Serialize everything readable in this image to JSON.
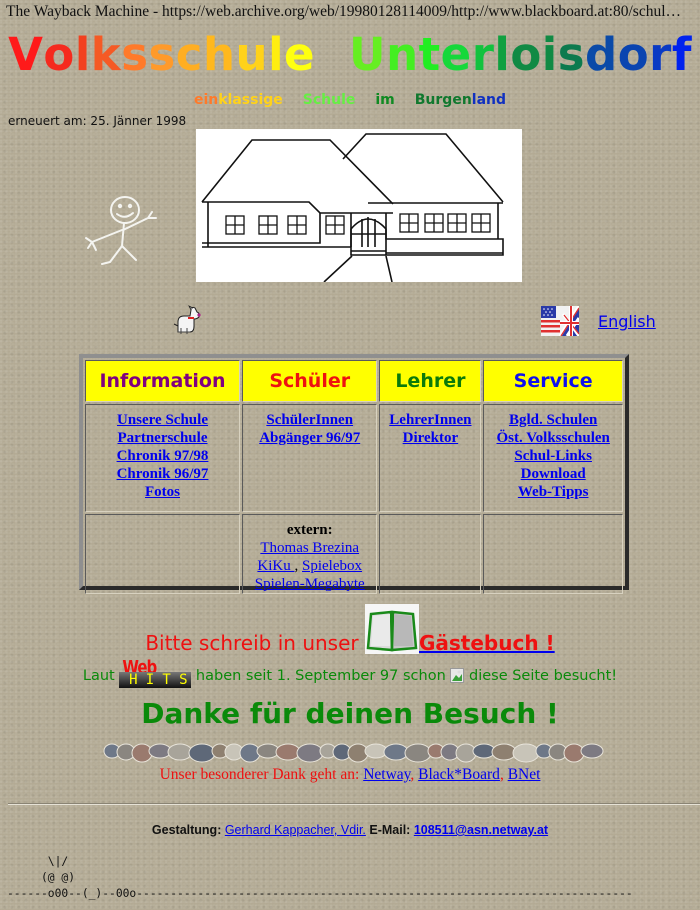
{
  "window": {
    "title": "The Wayback Machine - https://web.archive.org/web/19980128114009/http://www.blackboard.at:80/schul…"
  },
  "header": {
    "title_letters": [
      {
        "ch": "V",
        "color": "#ff1a1a"
      },
      {
        "ch": "o",
        "color": "#f52a1e"
      },
      {
        "ch": "l",
        "color": "#f2401f"
      },
      {
        "ch": "k",
        "color": "#f55a25"
      },
      {
        "ch": "s",
        "color": "#ff7a2a"
      },
      {
        "ch": "s",
        "color": "#ff9a2a"
      },
      {
        "ch": "c",
        "color": "#ffae22"
      },
      {
        "ch": "h",
        "color": "#ffb81e"
      },
      {
        "ch": "u",
        "color": "#ffd21a"
      },
      {
        "ch": "l",
        "color": "#ffee10"
      },
      {
        "ch": "e",
        "color": "#ffff10"
      },
      {
        "ch": " ",
        "color": "#000000"
      },
      {
        "ch": "U",
        "color": "#66ee22"
      },
      {
        "ch": "n",
        "color": "#44ee22"
      },
      {
        "ch": "t",
        "color": "#22ee22"
      },
      {
        "ch": "e",
        "color": "#16d83a"
      },
      {
        "ch": "r",
        "color": "#12c23e"
      },
      {
        "ch": "l",
        "color": "#10a040"
      },
      {
        "ch": "o",
        "color": "#108a44"
      },
      {
        "ch": "i",
        "color": "#108a44"
      },
      {
        "ch": "s",
        "color": "#0c7a4e"
      },
      {
        "ch": "d",
        "color": "#0a4aa8"
      },
      {
        "ch": "o",
        "color": "#0a44b0"
      },
      {
        "ch": "r",
        "color": "#0a3ac4"
      },
      {
        "ch": "f",
        "color": "#0022ee"
      }
    ],
    "subtitle_words": [
      {
        "parts": [
          {
            "text": "ein",
            "color": "#ff7a2a"
          },
          {
            "text": "klassige",
            "color": "#ffd21a"
          }
        ]
      },
      {
        "parts": [
          {
            "text": "Schule",
            "color": "#66ee44"
          }
        ]
      },
      {
        "parts": [
          {
            "text": "im",
            "color": "#108a22"
          }
        ]
      },
      {
        "parts": [
          {
            "text": "Burgen",
            "color": "#10782e"
          },
          {
            "text": "land",
            "color": "#1030c0"
          }
        ]
      }
    ],
    "updated": "erneuert am: 25. Jänner 1998"
  },
  "images": {
    "school_drawing": "school-building-drawing",
    "stickman": "chalk-stickman",
    "dog": "dog-icon",
    "flag": "uk-us-flag-icon"
  },
  "language_link": "English",
  "menu": {
    "columns": [
      {
        "heading": "Information",
        "color": "#800080",
        "links": [
          "Unsere Schule",
          "Partnerschule",
          "Chronik 97/98",
          "Chronik 96/97",
          "Fotos"
        ]
      },
      {
        "heading": "Schüler",
        "color": "#ee1111",
        "links": [
          "SchülerInnen",
          "Abgänger 96/97"
        ]
      },
      {
        "heading": "Lehrer",
        "color": "#0a7a0a",
        "links": [
          "LehrerInnen",
          "Direktor"
        ]
      },
      {
        "heading": "Service",
        "color": "#1010ee",
        "links": [
          "Bgld. Schulen",
          "Öst. Volksschulen",
          "Schul-Links",
          "Download",
          "Web-Tipps"
        ]
      }
    ],
    "extern": {
      "label": "extern:",
      "link1": "Thomas Brezina",
      "link2": "KiKu ",
      "separator": ", ",
      "link3": "Spielebox",
      "link4": "Spielen-Megabyte"
    }
  },
  "guestbook": {
    "text": "Bitte schreib in unser ",
    "link": "Gästebuch !"
  },
  "counter": {
    "before": "Laut ",
    "logo_top": "Web",
    "logo_letters": [
      "H",
      "I",
      "T",
      "S"
    ],
    "after_logo": " haben seit 1. September 97 schon ",
    "after_img": " diese Seite besucht!"
  },
  "danke": "Danke für deinen Besuch !",
  "thanks": {
    "text": "Unser besonderer Dank geht an: ",
    "links": [
      "Netway",
      "Black*Board",
      "BNet"
    ],
    "separator": ", "
  },
  "credits": {
    "label1": "Gestaltung: ",
    "author": "Gerhard Kappacher, Vdir.",
    "label2": " E-Mail: ",
    "email": "108511@asn.netway.at"
  },
  "ascii_art": "      \\|/\n     (@ @)\n------o00--(_)--00o-------------------------------------------------------------------------"
}
